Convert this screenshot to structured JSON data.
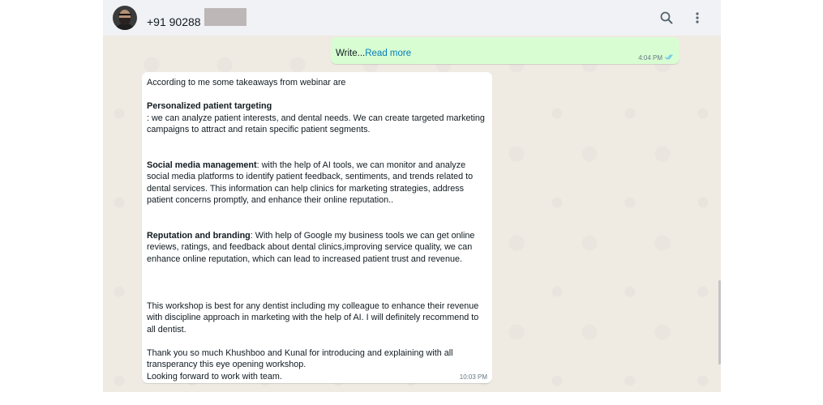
{
  "header": {
    "contact": "+91 90288 ",
    "icons": [
      "search-icon",
      "menu-dots-icon"
    ]
  },
  "outgoing": {
    "text": "Write...",
    "read_more": "Read more",
    "time": "4:04 PM",
    "status_icon": "double-check-icon"
  },
  "incoming": {
    "intro": "According to me some takeaways from webinar are",
    "s1_title": " Personalized patient targeting",
    "s1_body": ": we can analyze  patient  interests, and dental needs. We can create targeted marketing campaigns to attract and retain specific patient segments.",
    "s2_title": "Social media management",
    "s2_body": ": with the help of AI tools, we can monitor and analyze social media platforms to identify patient feedback, sentiments, and trends related to dental services. This information can help clinics for marketing strategies, address patient concerns promptly, and enhance their online reputation..",
    "s3_title": "Reputation and branding",
    "s3_body": ": With help of Google my business tools we can get online reviews, ratings, and feedback about dental clinics,improving service quality, we can enhance  online reputation, which can lead to increased patient trust and revenue.",
    "p4": "This workshop is best for any dentist including my colleague to enhance their revenue with discipline approach in marketing with the help of AI. I will definitely recommend to all dentist.",
    "p5": "Thank you so much  Khushboo and Kunal for  introducing and explaining with all transperancy this eye opening workshop.",
    "p6": "Looking forward to work with team.",
    "time": "10:03 PM"
  }
}
